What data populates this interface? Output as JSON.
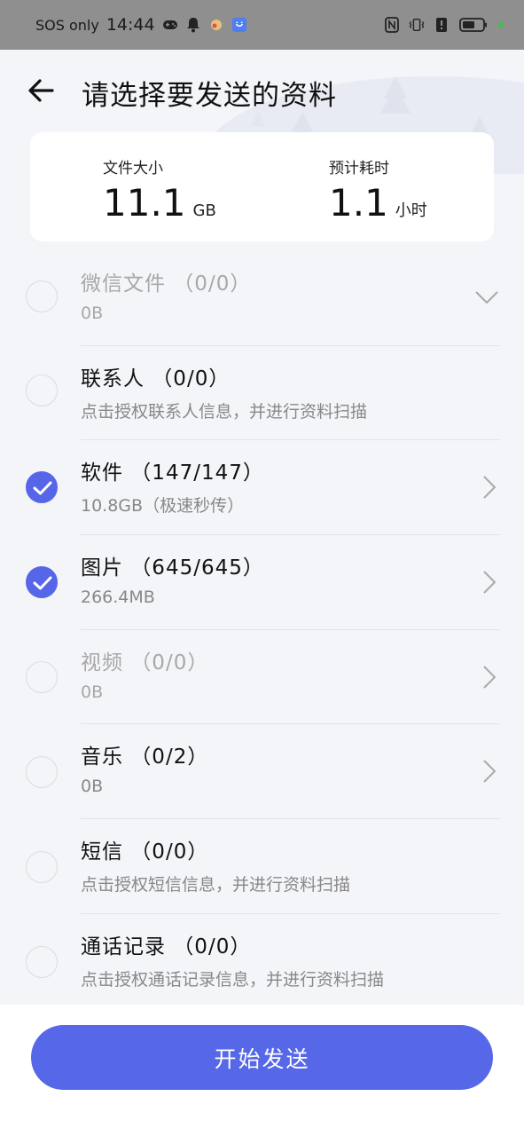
{
  "status_bar": {
    "carrier": "SOS only",
    "time": "14:44",
    "icons_left": [
      "gamepad-icon",
      "bell-icon",
      "app-notification-icon",
      "app-notification-icon-2"
    ],
    "icons_right": [
      "nfc-icon",
      "vibrate-icon",
      "alert-icon",
      "battery-icon",
      "wifi-dot-icon"
    ]
  },
  "header": {
    "title": "请选择要发送的资料",
    "back_icon": "arrow-left-icon"
  },
  "summary": {
    "size_label": "文件大小",
    "size_value": "11.1",
    "size_unit": "GB",
    "time_label": "预计耗时",
    "time_value": "1.1",
    "time_unit": "小时"
  },
  "items": [
    {
      "title": "微信文件 （0/0）",
      "sub": "0B",
      "checked": false,
      "disabled": true,
      "arrow": "chevron-down-icon"
    },
    {
      "title": "联系人 （0/0）",
      "sub": "点击授权联系人信息，并进行资料扫描",
      "checked": false,
      "disabled": false,
      "arrow": ""
    },
    {
      "title": "软件 （147/147）",
      "sub": "10.8GB（极速秒传）",
      "checked": true,
      "disabled": false,
      "arrow": "chevron-right-icon"
    },
    {
      "title": "图片 （645/645）",
      "sub": "266.4MB",
      "checked": true,
      "disabled": false,
      "arrow": "chevron-right-icon"
    },
    {
      "title": "视频 （0/0）",
      "sub": "0B",
      "checked": false,
      "disabled": true,
      "arrow": "chevron-right-icon"
    },
    {
      "title": "音乐 （0/2）",
      "sub": "0B",
      "checked": false,
      "disabled": false,
      "arrow": "chevron-right-icon"
    },
    {
      "title": "短信 （0/0）",
      "sub": "点击授权短信信息，并进行资料扫描",
      "checked": false,
      "disabled": false,
      "arrow": ""
    },
    {
      "title": "通话记录 （0/0）",
      "sub": "点击授权通话记录信息，并进行资料扫描",
      "checked": false,
      "disabled": false,
      "arrow": ""
    }
  ],
  "bottom": {
    "start_label": "开始发送"
  },
  "colors": {
    "accent": "#5567e8",
    "background": "#f4f5f9",
    "disabled_text": "#a8a8a8"
  }
}
